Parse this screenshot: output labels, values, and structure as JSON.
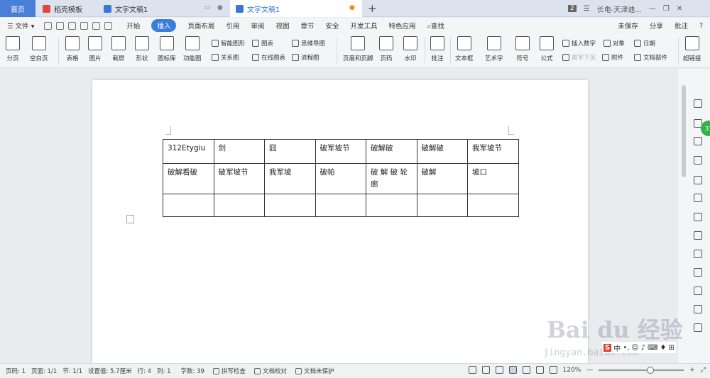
{
  "tabs": {
    "home": "首页",
    "template": "稻壳模板",
    "doc1": "文字文稿1",
    "doc2": "文字文稿1"
  },
  "window": {
    "badge": "2",
    "user": "长电-天津迪..."
  },
  "menu": {
    "file": "文件",
    "items": [
      "开始",
      "插入",
      "页面布局",
      "引用",
      "审阅",
      "视图",
      "章节",
      "安全",
      "开发工具",
      "特色应用"
    ],
    "active_index": 1,
    "search": "查找",
    "unsaved": "未保存",
    "share": "分享",
    "comment": "批注",
    "help": "?"
  },
  "ribbon": {
    "page_break": "分页",
    "blank_page": "空白页",
    "table": "表格",
    "picture": "图片",
    "screenshot": "截屏",
    "shape": "形状",
    "icon_lib": "图标库",
    "func_chart": "功能图",
    "smart_shape": "智能图形",
    "chart": "图表",
    "mind_map": "思维导图",
    "relation": "关系图",
    "online_chart": "在线图表",
    "flowchart": "流程图",
    "header_footer": "页眉和页脚",
    "page_num": "页码",
    "watermark": "水印",
    "annotate": "批注",
    "textbox": "文本框",
    "wordart": "艺术字",
    "symbol": "符号",
    "formula": "公式",
    "insert_number": "插入数字",
    "object": "对象",
    "date": "日期",
    "drop_cap": "首字下沉",
    "attachment": "附件",
    "doc_parts": "文档部件",
    "hyperlink": "超链接"
  },
  "table": {
    "rows": [
      [
        "312Etygiu",
        "剑",
        "囧",
        "破军坡节",
        "破解破",
        "破解破",
        "我军坡节"
      ],
      [
        "破解看破",
        "破军坡节",
        "我军坡",
        "破帕",
        "破 解 破 轮 廓",
        "破解",
        "坡口"
      ],
      [
        "",
        "",
        "",
        "",
        "",
        "",
        ""
      ]
    ]
  },
  "sidebar": {
    "badge": "37"
  },
  "watermark": {
    "logo": "Bai du 经验",
    "url": "jingyan.baidu.com"
  },
  "ime": {
    "s": "S",
    "lang": "中"
  },
  "status": {
    "page": "页码: 1",
    "pages": "页面: 1/1",
    "section": "节: 1/1",
    "setting": "设置值: 5.7厘米",
    "row": "行: 4",
    "col": "列: 1",
    "wordcount": "字数: 39",
    "spell": "拼写检查",
    "proof": "文档校对",
    "protect": "文档未保护",
    "zoom": "120%"
  }
}
